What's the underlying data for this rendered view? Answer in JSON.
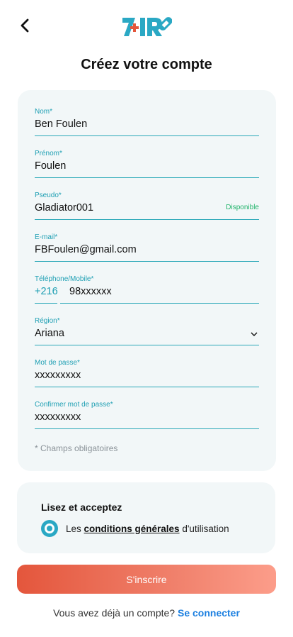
{
  "header": {
    "title": "Créez votre compte"
  },
  "form": {
    "fields": [
      {
        "label": "Nom*",
        "value": "Ben Foulen"
      },
      {
        "label": "Prénom*",
        "value": "Foulen"
      },
      {
        "label": "Pseudo*",
        "value": "Gladiator001",
        "status": "Disponible"
      },
      {
        "label": "E-mail*",
        "value": "FBFoulen@gmail.com"
      },
      {
        "label": "Téléphone/Mobile*",
        "code": "+216",
        "value": "98xxxxxx"
      },
      {
        "label": "Région*",
        "value": "Ariana"
      },
      {
        "label": "Mot de passe*",
        "value": "xxxxxxxxx"
      },
      {
        "label": "Confirmer mot de passe*",
        "value": "xxxxxxxxx"
      }
    ],
    "required_note": "* Champs obligatoires"
  },
  "terms": {
    "title": "Lisez et acceptez",
    "prefix": "Les ",
    "link": "conditions générales",
    "suffix": " d'utilisation",
    "accepted": true
  },
  "submit_label": "S'inscrire",
  "login": {
    "prompt": "Vous avez déjà un compte? ",
    "link": "Se connecter"
  },
  "colors": {
    "accent": "#2aa8b8",
    "button_start": "#e4563c",
    "button_end": "#fc9d8a",
    "link": "#1b7fe0",
    "available": "#20b36a"
  }
}
